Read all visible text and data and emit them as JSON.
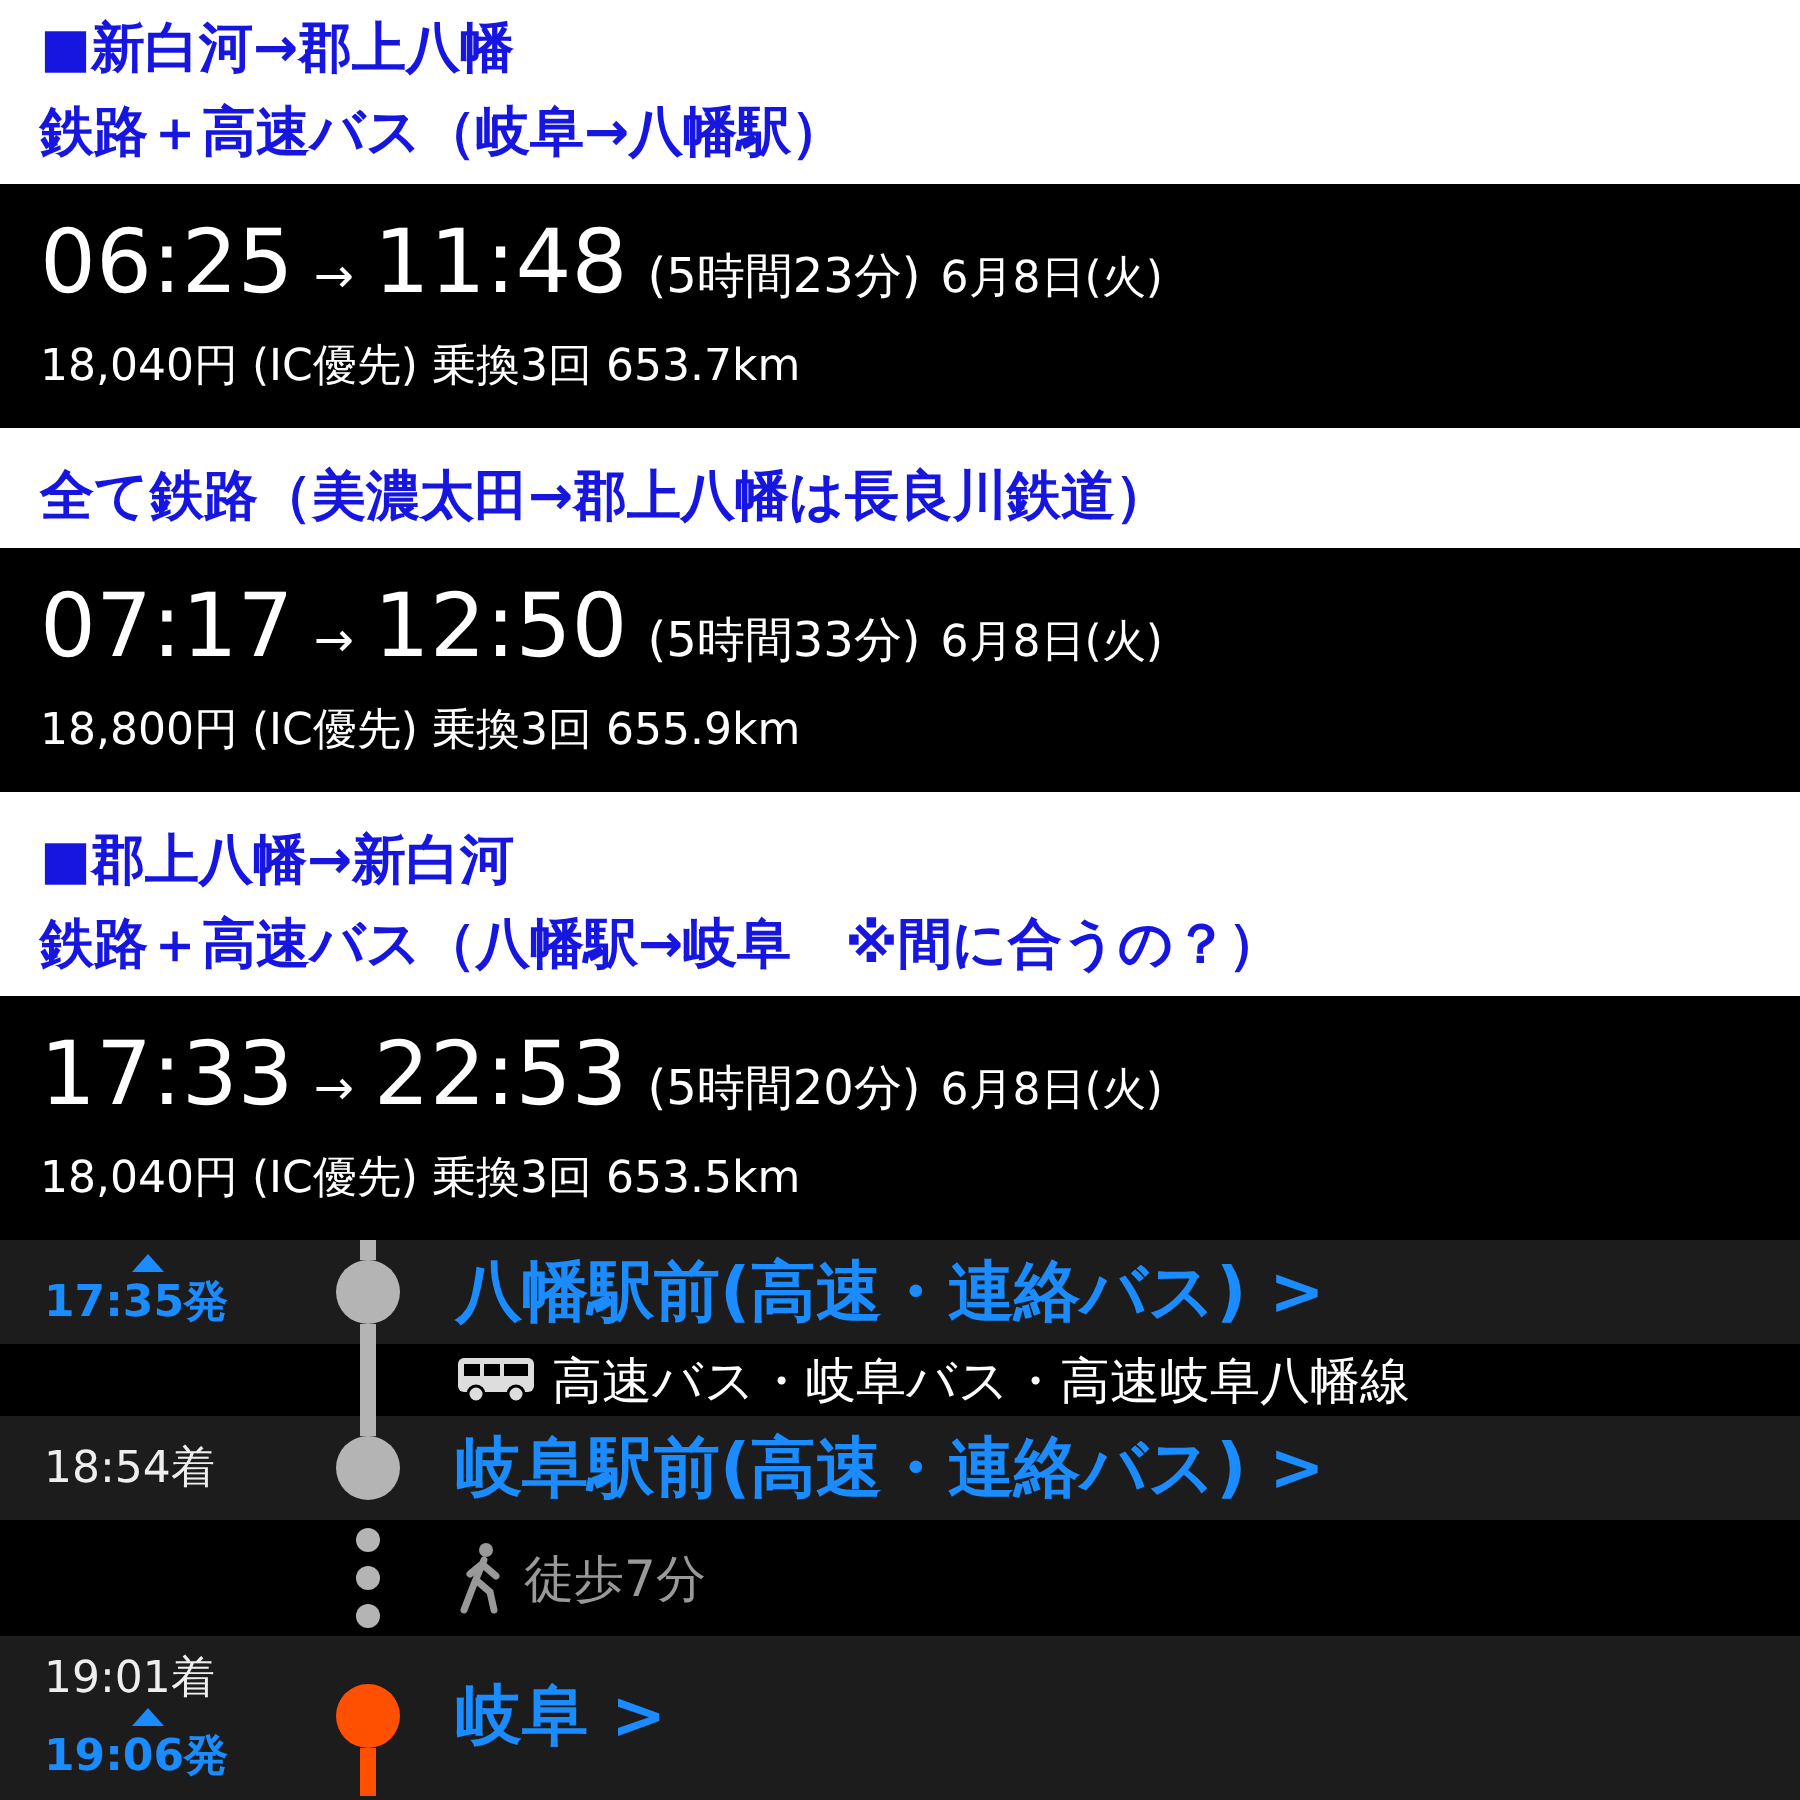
{
  "sections": [
    {
      "kind": "heading",
      "lines": [
        "■新白河→郡上八幡",
        "鉄路＋高速バス（岐阜→八幡駅）"
      ]
    },
    {
      "kind": "route",
      "depart": "06:25",
      "arrow": "→",
      "arrive": "11:48",
      "duration": "(5時間23分)",
      "date": "6月8日(火)",
      "summary": "18,040円 (IC優先) 乗換3回 653.7km"
    },
    {
      "kind": "heading",
      "lines": [
        "全て鉄路（美濃太田→郡上八幡は長良川鉄道）"
      ]
    },
    {
      "kind": "route",
      "depart": "07:17",
      "arrow": "→",
      "arrive": "12:50",
      "duration": "(5時間33分)",
      "date": "6月8日(火)",
      "summary": "18,800円 (IC優先) 乗換3回 655.9km"
    },
    {
      "kind": "heading",
      "lines": [
        "■郡上八幡→新白河",
        "鉄路＋高速バス（八幡駅→岐阜　※間に合うの？）"
      ]
    },
    {
      "kind": "route",
      "depart": "17:33",
      "arrow": "→",
      "arrive": "22:53",
      "duration": "(5時間20分)",
      "date": "6月8日(火)",
      "summary": "18,040円 (IC優先) 乗換3回 653.5km"
    }
  ],
  "timeline": [
    {
      "kind": "stop",
      "departure": "17:35発",
      "station": "八幡駅前(高速・連絡バス)",
      "chevron": ">",
      "color": "#b4b4b4"
    },
    {
      "kind": "bus",
      "text": "高速バス・岐阜バス・高速岐阜八幡線"
    },
    {
      "kind": "stop",
      "arrival": "18:54着",
      "station": "岐阜駅前(高速・連絡バス)",
      "chevron": ">",
      "color": "#b4b4b4"
    },
    {
      "kind": "walk",
      "text": "徒歩7分"
    },
    {
      "kind": "stop",
      "arrival": "19:01着",
      "departure": "19:06発",
      "station": "岐阜",
      "chevron": ">",
      "color": "#ff4f00"
    }
  ]
}
